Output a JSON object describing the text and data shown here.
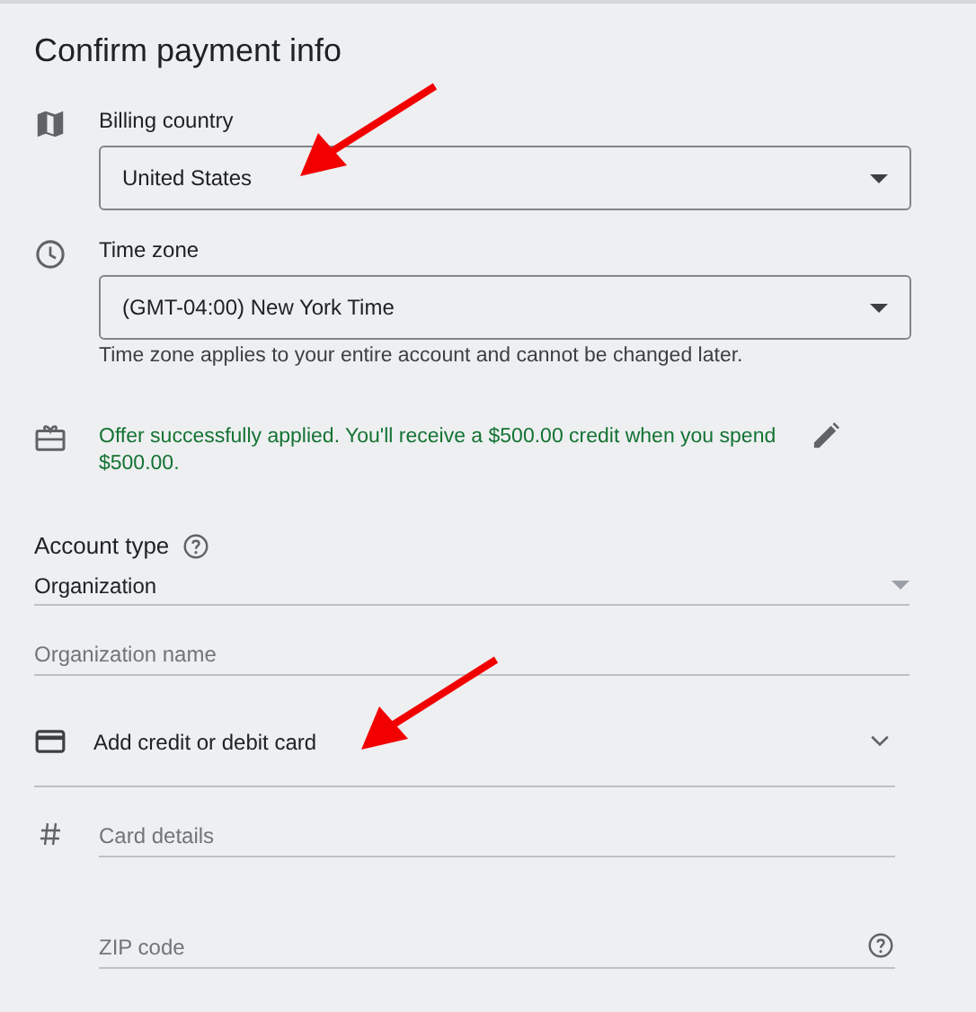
{
  "title": "Confirm payment info",
  "billing_country": {
    "label": "Billing country",
    "value": "United States"
  },
  "time_zone": {
    "label": "Time zone",
    "value": "(GMT-04:00) New York Time",
    "hint": "Time zone applies to your entire account and cannot be changed later."
  },
  "offer": {
    "message": "Offer successfully applied. You'll receive a $500.00 credit when you spend $500.00."
  },
  "account_type": {
    "label": "Account type",
    "value": "Organization"
  },
  "organization_name": {
    "placeholder": "Organization name"
  },
  "payment_method": {
    "label": "Add credit or debit card",
    "expanded": true
  },
  "card_details": {
    "placeholder": "Card details"
  },
  "zip_code": {
    "placeholder": "ZIP code"
  }
}
